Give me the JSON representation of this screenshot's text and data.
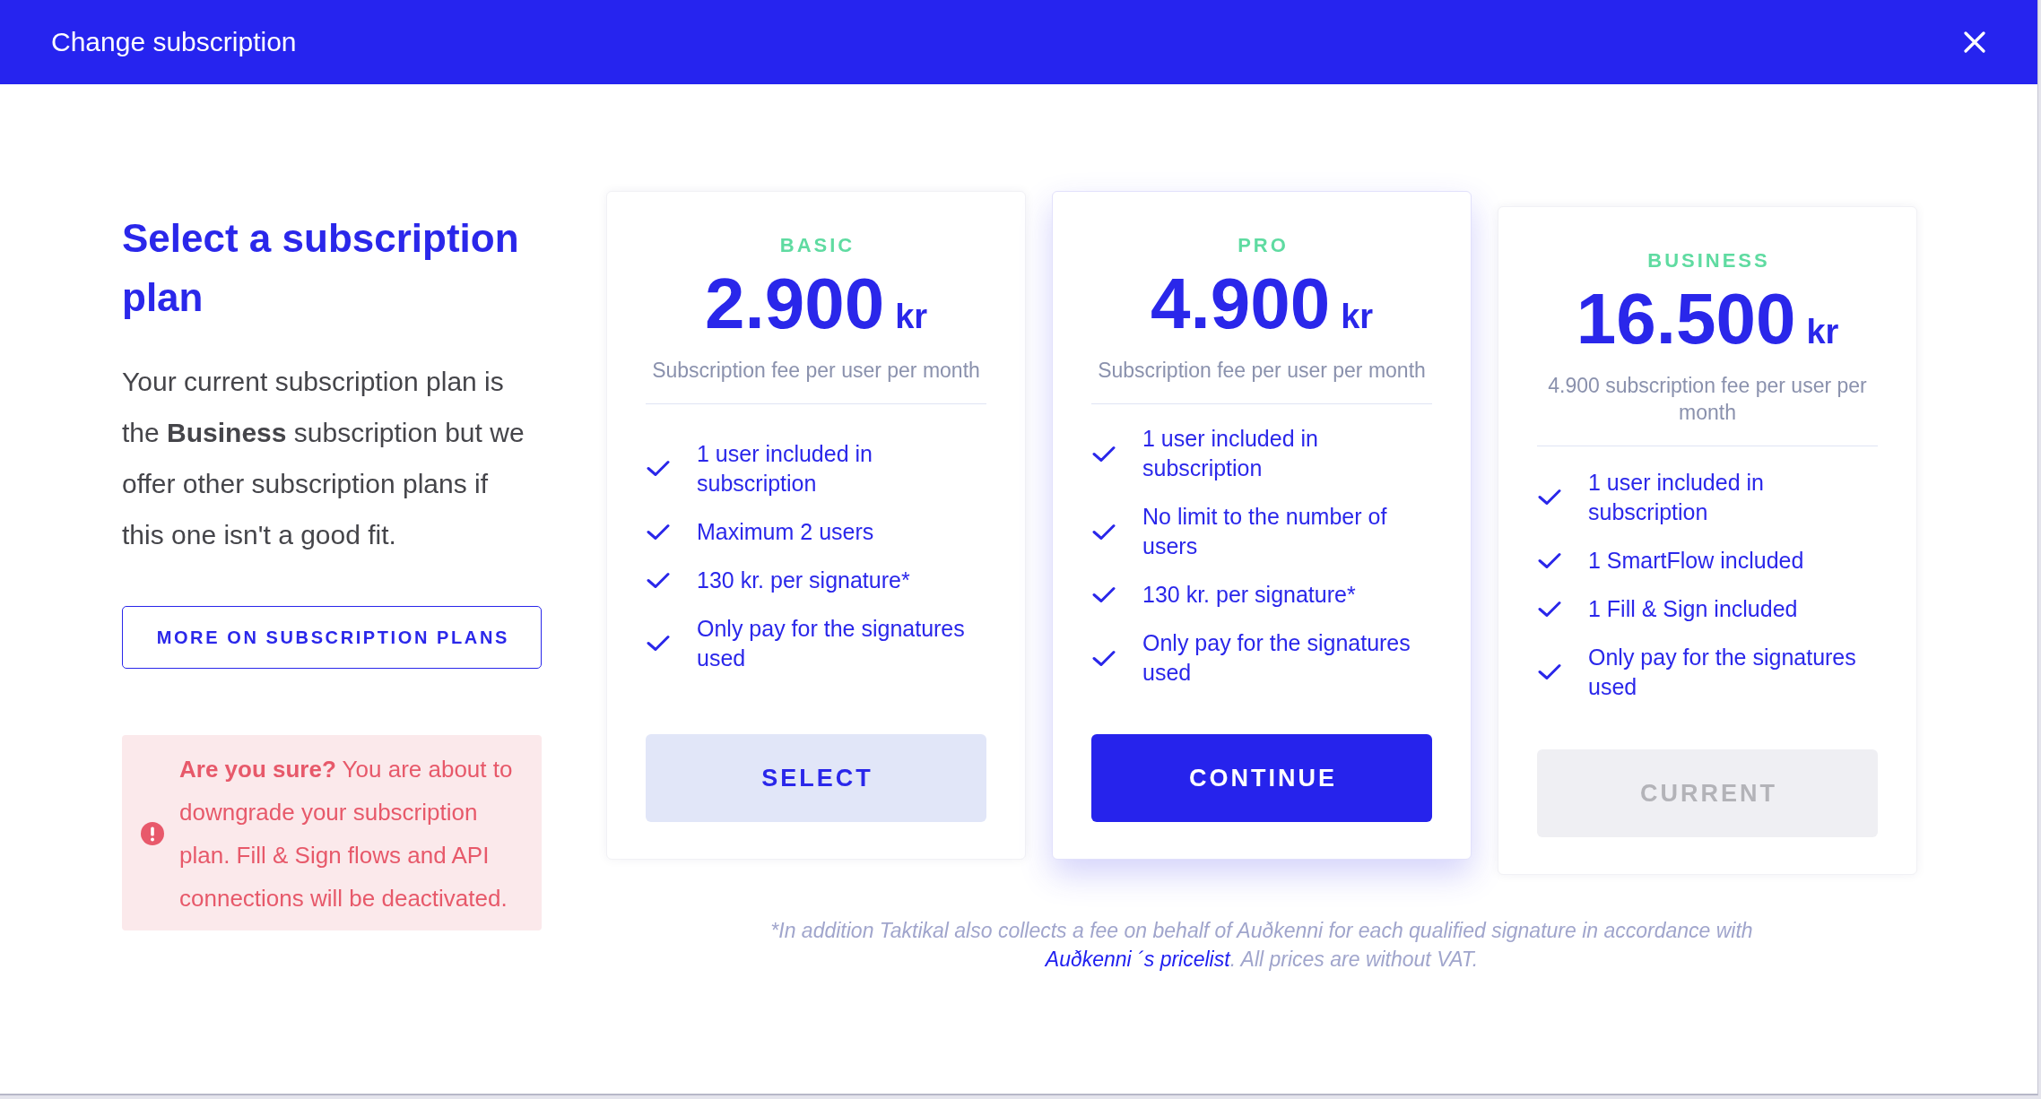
{
  "dialog": {
    "title": "Change subscription"
  },
  "intro": {
    "heading": "Select a subscription plan",
    "text": "Your current subscription plan is the **Business** subscription but we offer other subscription plans if this one isn't a good fit.",
    "button": "MORE ON SUBSCRIPTION PLANS"
  },
  "warning": {
    "text": "**Are you sure?** You are about to downgrade your subscription plan. Fill & Sign flows and API connections will be deactivated."
  },
  "plans": [
    {
      "name": "BASIC",
      "price": "2.900",
      "currency": "kr",
      "note": "Subscription fee per user per month",
      "features": [
        "1 user included in subscription",
        "Maximum 2 users",
        "130 kr. per signature*",
        "Only pay for the signatures used"
      ],
      "selected": false,
      "current": false,
      "button": "SELECT"
    },
    {
      "name": "PRO",
      "price": "4.900",
      "currency": "kr",
      "note": "Subscription fee per user per month",
      "features": [
        "1 user included in subscription",
        "No limit to the number of users",
        "130 kr. per signature*",
        "Only pay for the signatures used"
      ],
      "selected": true,
      "current": false,
      "button": "CONTINUE"
    },
    {
      "name": "BUSINESS",
      "price": "16.500",
      "currency": "kr",
      "note": "4.900 subscription fee per user per month",
      "features": [
        "1 user included in subscription",
        "1 SmartFlow included",
        "1 Fill & Sign included",
        "Only pay for the signatures used"
      ],
      "selected": false,
      "current": true,
      "button": "CURRENT"
    }
  ],
  "footnote": {
    "text": "*In addition Taktikal also collects a fee on behalf of Auðkenni for each qualified signature in accordance with",
    "link": "Auðkenni ´s pricelist",
    "after": ". All prices are without VAT."
  }
}
